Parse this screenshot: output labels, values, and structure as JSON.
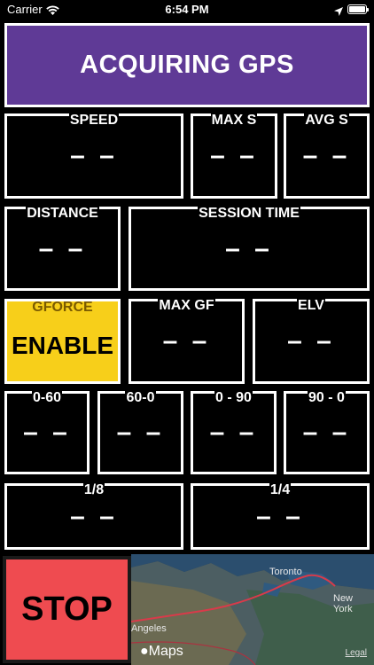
{
  "status_bar": {
    "carrier": "Carrier",
    "time": "6:54 PM"
  },
  "header": {
    "title": "ACQUIRING GPS",
    "background": "#5f3a96"
  },
  "tiles": {
    "speed": {
      "label": "SPEED",
      "value": "– –"
    },
    "max_s": {
      "label": "MAX S",
      "value": "– –"
    },
    "avg_s": {
      "label": "AVG S",
      "value": "– –"
    },
    "distance": {
      "label": "DISTANCE",
      "value": "– –"
    },
    "session_time": {
      "label": "SESSION TIME",
      "value": "– –"
    },
    "max_gf": {
      "label": "MAX GF",
      "value": "– –"
    },
    "elv": {
      "label": "ELV",
      "value": "– –"
    },
    "zero_60": {
      "label": "0-60",
      "value": "– –"
    },
    "sixty_0": {
      "label": "60-0",
      "value": "– –"
    },
    "zero_90": {
      "label": "0 - 90",
      "value": "– –"
    },
    "ninety_0": {
      "label": "90 - 0",
      "value": "– –"
    },
    "eighth": {
      "label": "1/8",
      "value": "– –"
    },
    "quarter": {
      "label": "1/4",
      "value": "– –"
    }
  },
  "gforce": {
    "label": "GFORCE",
    "button": "ENABLE",
    "color": "#f7cf1a"
  },
  "stop": {
    "label": "STOP",
    "color": "#ef4b50"
  },
  "map": {
    "places": [
      "Toronto",
      "New York",
      "Angeles"
    ],
    "brand": "Maps",
    "legal": "Legal"
  }
}
